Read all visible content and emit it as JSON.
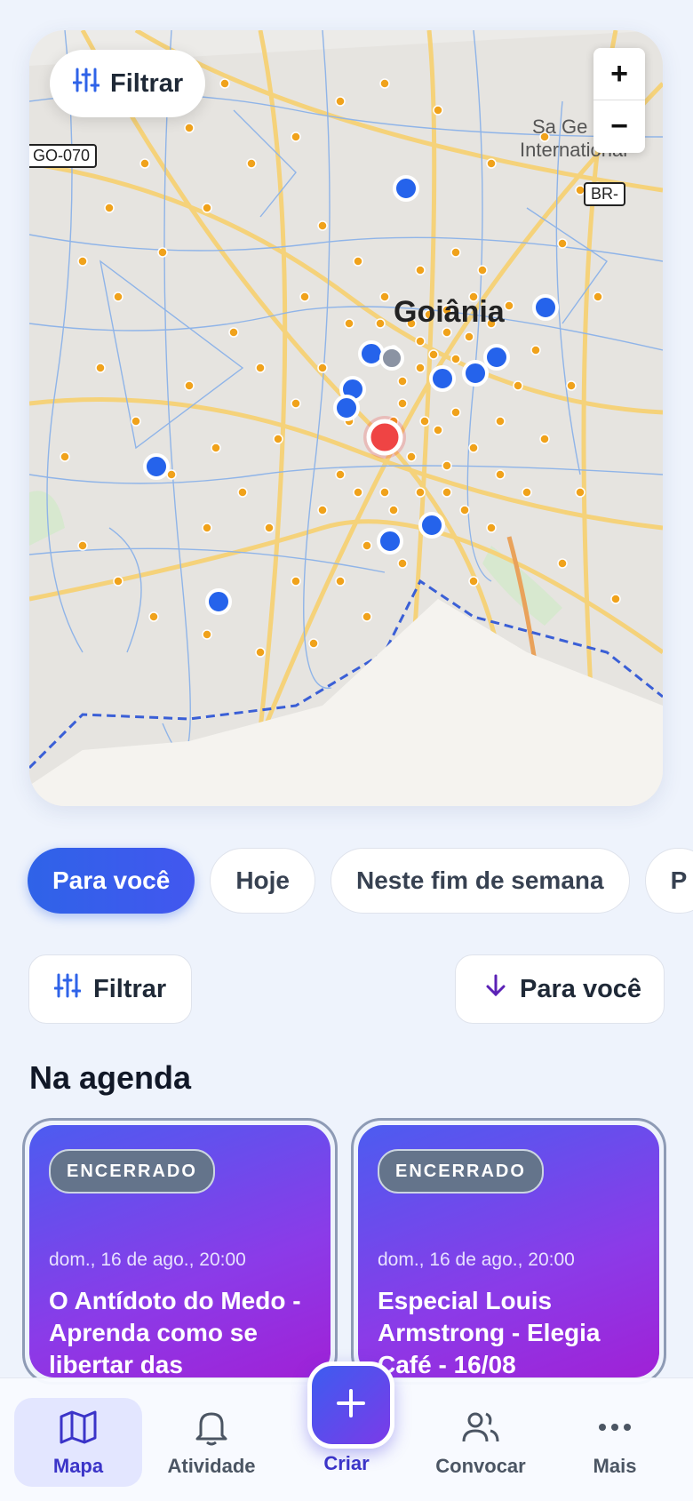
{
  "map": {
    "filter_label": "Filtrar",
    "zoom_in": "+",
    "zoom_out": "−",
    "city_label": "Goiânia",
    "airport_label_1": "Sa  Ge",
    "airport_label_2": "International",
    "shield_1": "GO-070",
    "shield_2": "BR-"
  },
  "chips": [
    "Para você",
    "Hoje",
    "Neste fim de semana",
    "P"
  ],
  "filters": {
    "filter_label": "Filtrar",
    "sort_label": "Para você"
  },
  "section_title": "Na agenda",
  "cards": [
    {
      "status": "ENCERRADO",
      "date": "dom., 16 de ago., 20:00",
      "title": "O Antídoto do Medo - Aprenda como se libertar das"
    },
    {
      "status": "ENCERRADO",
      "date": "dom., 16 de ago., 20:00",
      "title": "Especial Louis Armstrong - Elegia Café - 16/08"
    }
  ],
  "nav": {
    "mapa": "Mapa",
    "atividade": "Atividade",
    "criar": "Criar",
    "convocar": "Convocar",
    "mais": "Mais"
  },
  "colors": {
    "accent": "#3b34c8",
    "primary_blue": "#2f63e8",
    "marker_orange": "#f0a21b",
    "marker_blue": "#2563eb",
    "marker_red": "#ef4444"
  }
}
